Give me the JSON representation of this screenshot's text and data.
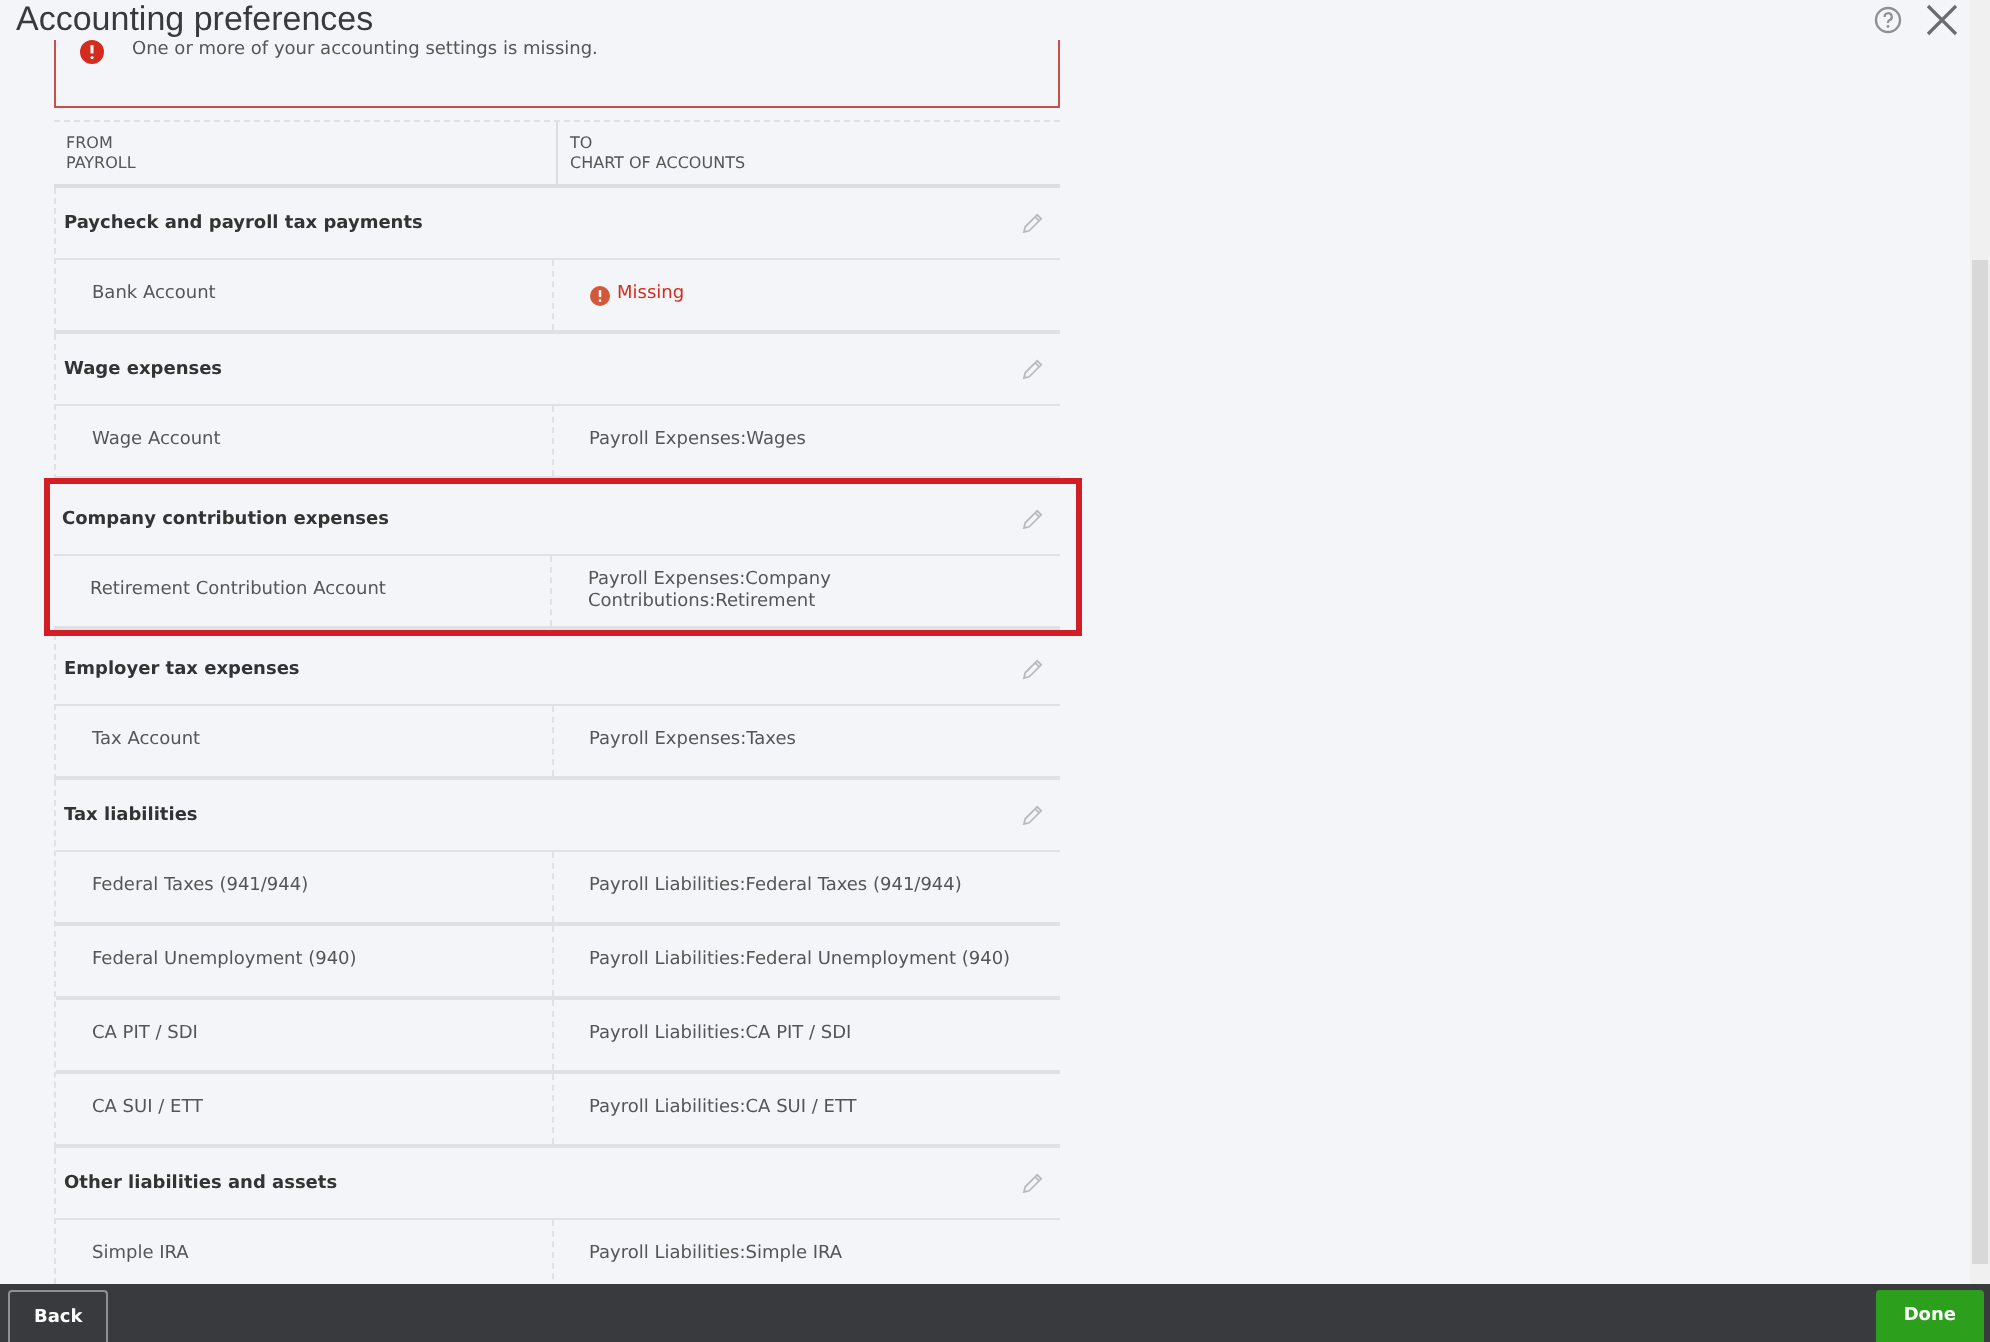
{
  "window": {
    "title": "Accounting preferences"
  },
  "alert": {
    "message": "One or more of your accounting settings is missing."
  },
  "table": {
    "columns": [
      {
        "line1": "FROM",
        "line2": "PAYROLL"
      },
      {
        "line1": "TO",
        "line2": "CHART OF ACCOUNTS"
      }
    ],
    "groups": [
      {
        "title": "Paycheck and payroll tax payments",
        "highlighted": false,
        "rows": [
          {
            "from": "Bank Account",
            "to": "Missing",
            "missing": true
          }
        ]
      },
      {
        "title": "Wage expenses",
        "highlighted": false,
        "rows": [
          {
            "from": "Wage Account",
            "to": "Payroll Expenses:Wages",
            "missing": false
          }
        ]
      },
      {
        "title": "Company contribution expenses",
        "highlighted": true,
        "rows": [
          {
            "from": "Retirement Contribution Account",
            "to": "Payroll Expenses:Company Contributions:Retirement",
            "missing": false
          }
        ]
      },
      {
        "title": "Employer tax expenses",
        "highlighted": false,
        "rows": [
          {
            "from": "Tax Account",
            "to": "Payroll Expenses:Taxes",
            "missing": false
          }
        ]
      },
      {
        "title": "Tax liabilities",
        "highlighted": false,
        "rows": [
          {
            "from": "Federal Taxes (941/944)",
            "to": "Payroll Liabilities:Federal Taxes (941/944)",
            "missing": false
          },
          {
            "from": "Federal Unemployment (940)",
            "to": "Payroll Liabilities:Federal Unemployment (940)",
            "missing": false
          },
          {
            "from": "CA PIT / SDI",
            "to": "Payroll Liabilities:CA PIT / SDI",
            "missing": false
          },
          {
            "from": "CA SUI / ETT",
            "to": "Payroll Liabilities:CA SUI / ETT",
            "missing": false
          }
        ]
      },
      {
        "title": "Other liabilities and assets",
        "highlighted": false,
        "rows": [
          {
            "from": "Simple IRA",
            "to": "Payroll Liabilities:Simple IRA",
            "missing": false
          }
        ]
      }
    ]
  },
  "footer": {
    "back": "Back",
    "done": "Done"
  }
}
